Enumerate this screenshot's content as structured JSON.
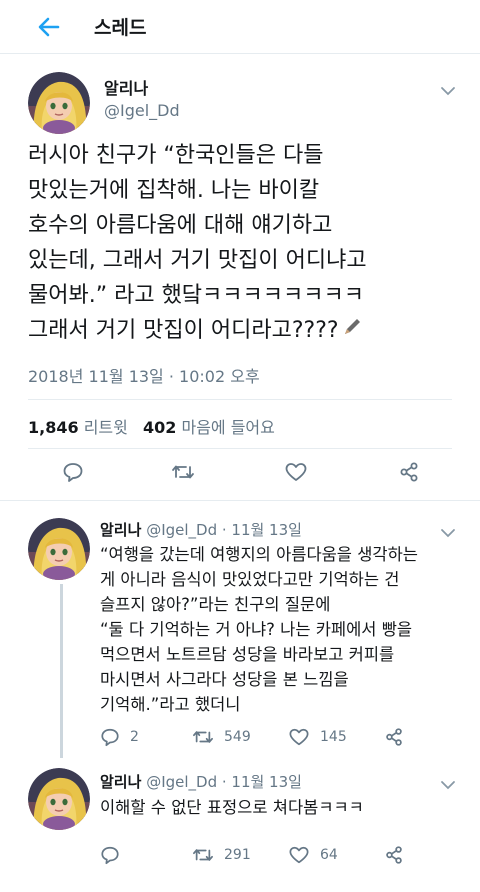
{
  "header": {
    "title": "스레드"
  },
  "tweet": {
    "name": "알리나",
    "handle": "@Igel_Dd",
    "body_lines": [
      "러시아 친구가 “한국인들은 다들",
      "맛있는거에 집착해. 나는 바이칼",
      "호수의 아름다움에 대해 얘기하고",
      "있는데, 그래서 거기 맛집이 어디냐고",
      "물어봐.” 라고 했닼ㅋㅋㅋㅋㅋㅋㅋㅋ",
      "그래서 거기 맛집이 어디라고????"
    ],
    "timestamp": "2018년 11월 13일 · 10:02 오후",
    "retweet_count": "1,846",
    "retweet_label": "리트윗",
    "like_count": "402",
    "like_label": "마음에 들어요"
  },
  "replies": [
    {
      "name": "알리나",
      "meta": "@Igel_Dd · 11월 13일",
      "body_lines": [
        "“여행을 갔는데 여행지의 아름다움을 생각하는",
        "게 아니라 음식이 맛있었다고만 기억하는 건",
        "슬프지 않아?”라는 친구의 질문에",
        "“둘 다 기억하는 거 아냐? 나는 카페에서 빵을",
        "먹으면서 노트르담 성당을 바라보고 커피를",
        "마시면서 사그라다 성당을 본 느낌을",
        "기억해.”라고 했더니"
      ],
      "reply_count": "2",
      "retweet_count": "549",
      "like_count": "145"
    },
    {
      "name": "알리나",
      "meta": "@Igel_Dd · 11월 13일",
      "body_lines": [
        "이해할 수 없단 표정으로 쳐다봄ㅋㅋㅋ"
      ],
      "reply_count": "",
      "retweet_count": "291",
      "like_count": "64"
    }
  ],
  "icons": {
    "back": "arrow-left-icon",
    "reply": "speech-bubble-icon",
    "retweet": "retweet-icon",
    "like": "heart-icon",
    "share": "share-icon",
    "more": "chevron-down-icon",
    "edit": "pencil-icon"
  },
  "colors": {
    "accent": "#1da1f2",
    "muted": "#657786",
    "text": "#14171a",
    "divider": "#e6ecf0"
  }
}
